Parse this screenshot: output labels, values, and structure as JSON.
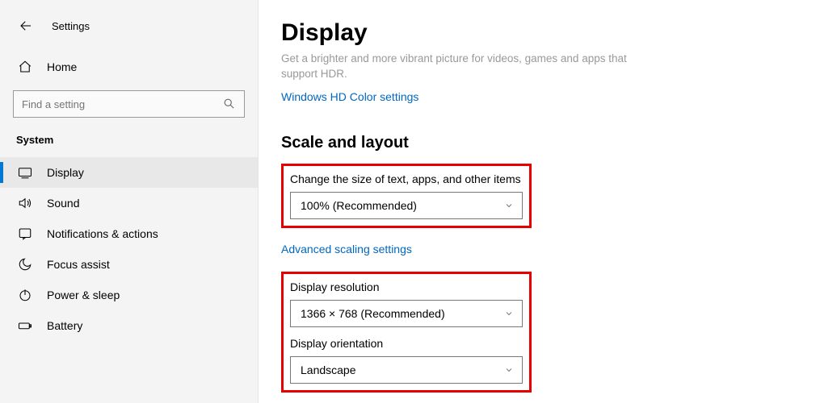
{
  "header": {
    "app_title": "Settings",
    "page_title": "Display"
  },
  "sidebar": {
    "home_label": "Home",
    "search_placeholder": "Find a setting",
    "category_label": "System",
    "items": [
      {
        "label": "Display"
      },
      {
        "label": "Sound"
      },
      {
        "label": "Notifications & actions"
      },
      {
        "label": "Focus assist"
      },
      {
        "label": "Power & sleep"
      },
      {
        "label": "Battery"
      }
    ]
  },
  "main": {
    "hdr_sub": "Get a brighter and more vibrant picture for videos, games and apps that support HDR.",
    "hdr_link": "Windows HD Color settings",
    "scale_section": "Scale and layout",
    "scale_label": "Change the size of text, apps, and other items",
    "scale_value": "100% (Recommended)",
    "advanced_scaling_link": "Advanced scaling settings",
    "resolution_label": "Display resolution",
    "resolution_value": "1366 × 768 (Recommended)",
    "orientation_label": "Display orientation",
    "orientation_value": "Landscape"
  }
}
